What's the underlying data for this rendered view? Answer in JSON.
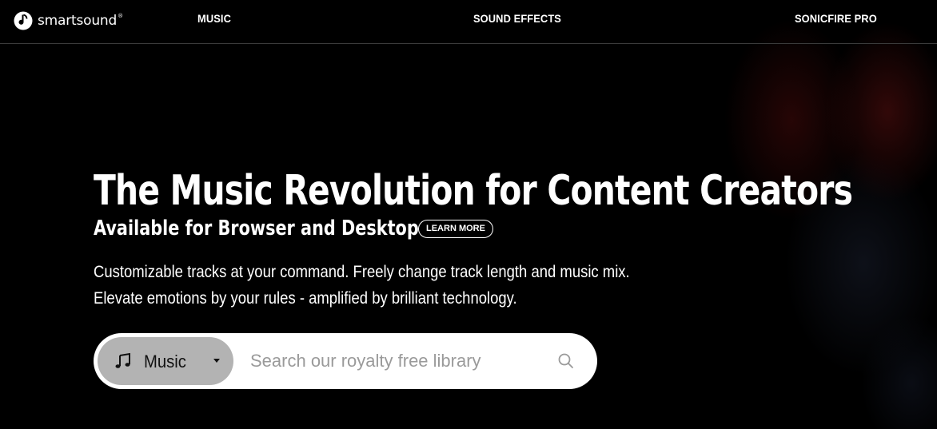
{
  "brand": {
    "name": "smartsound",
    "trademark": "®"
  },
  "nav": {
    "items": [
      {
        "label": "MUSIC"
      },
      {
        "label": "SOUND EFFECTS"
      },
      {
        "label": "SONICFIRE PRO"
      }
    ]
  },
  "hero": {
    "title": "The Music Revolution for Content Creators",
    "subtitle": "Available for Browser and Desktop",
    "learn_more_label": "LEARN MORE",
    "description_lines": [
      "Customizable tracks at your command. Freely change track length and music mix.",
      "Elevate emotions by your rules - amplified by brilliant technology."
    ]
  },
  "search": {
    "type_selected": "Music",
    "type_icon": "music-note-icon",
    "placeholder": "Search our royalty free library",
    "value": ""
  },
  "colors": {
    "background": "#000000",
    "text": "#ffffff",
    "search_bg": "#ffffff",
    "select_bg": "#b3b3b3",
    "placeholder": "#9a9a9a"
  }
}
